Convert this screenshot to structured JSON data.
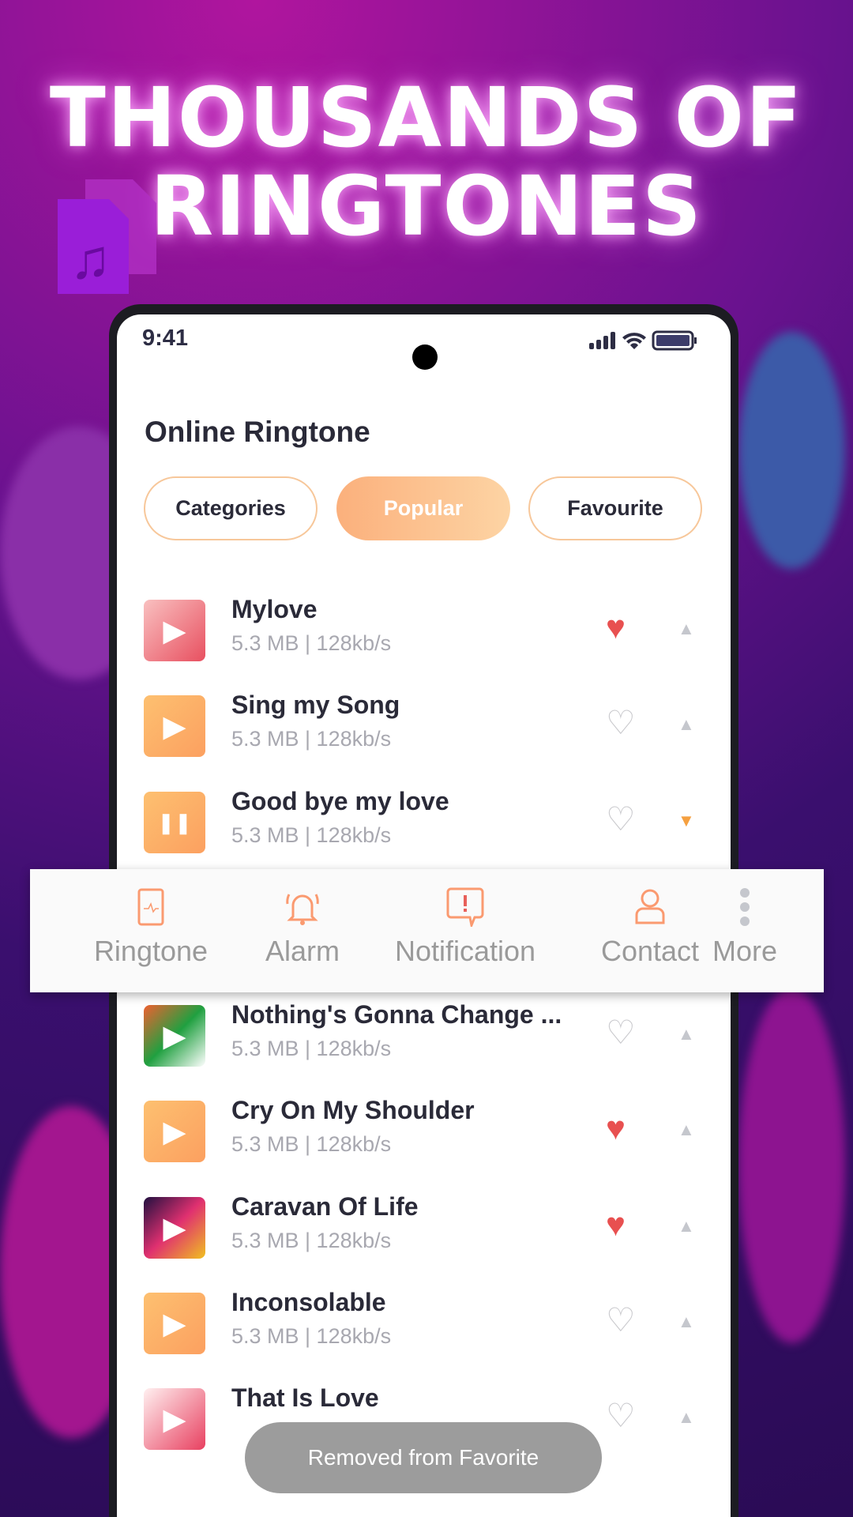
{
  "headline": {
    "line1": "THOUSANDS OF",
    "line2": "RINGTONES"
  },
  "status": {
    "time": "9:41"
  },
  "page_title": "Online Ringtone",
  "tabs": [
    {
      "label": "Categories",
      "active": false
    },
    {
      "label": "Popular",
      "active": true
    },
    {
      "label": "Favourite",
      "active": false
    }
  ],
  "ringtones": [
    {
      "name": "Mylove",
      "info": "5.3 MB | 128kb/s",
      "favorite": true,
      "state": "play"
    },
    {
      "name": "Sing my Song",
      "info": "5.3 MB | 128kb/s",
      "favorite": false,
      "state": "play"
    },
    {
      "name": "Good bye my love",
      "info": "5.3 MB | 128kb/s",
      "favorite": false,
      "state": "pause"
    },
    {
      "name": "Nothing's Gonna Change ...",
      "info": "5.3 MB | 128kb/s",
      "favorite": false,
      "state": "play"
    },
    {
      "name": "Cry On My Shoulder",
      "info": "5.3 MB | 128kb/s",
      "favorite": true,
      "state": "play"
    },
    {
      "name": "Caravan Of Life",
      "info": "5.3 MB | 128kb/s",
      "favorite": true,
      "state": "play"
    },
    {
      "name": "Inconsolable",
      "info": "5.3 MB | 128kb/s",
      "favorite": false,
      "state": "play"
    },
    {
      "name": "That Is Love",
      "info": "",
      "favorite": false,
      "state": "play"
    }
  ],
  "set_as_menu": [
    {
      "label": "Ringtone",
      "icon": "phone-icon"
    },
    {
      "label": "Alarm",
      "icon": "bell-icon"
    },
    {
      "label": "Notification",
      "icon": "alert-message-icon"
    },
    {
      "label": "Contact",
      "icon": "person-icon"
    },
    {
      "label": "More",
      "icon": "more-vertical-icon"
    }
  ],
  "toast": "Removed from Favorite",
  "colors": {
    "accent": "#fbb07c",
    "heart": "#e85050",
    "expanded_arrow": "#f5a040"
  }
}
